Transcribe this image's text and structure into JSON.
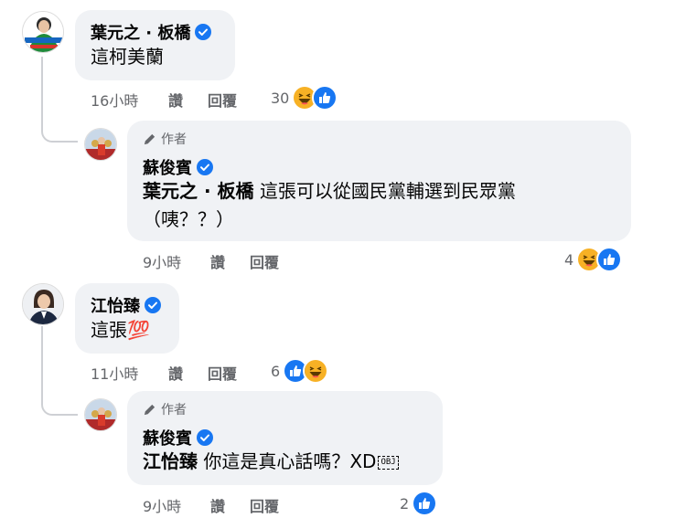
{
  "comments": [
    {
      "author": "葉元之 · 板橋",
      "text": "這柯美蘭",
      "time": "16小時",
      "like_label": "讚",
      "reply_label": "回覆",
      "reaction_count": "30",
      "reactions": [
        "haha",
        "like"
      ]
    },
    {
      "tag": "作者",
      "author": "蘇俊賓",
      "mention": "葉元之 · 板橋",
      "text_line1": "這張可以從國民黨輔選到民眾黨",
      "text_line2": "（咦？？）",
      "time": "9小時",
      "like_label": "讚",
      "reply_label": "回覆",
      "reaction_count": "4",
      "reactions": [
        "haha",
        "like"
      ]
    },
    {
      "author": "江怡臻",
      "text": "這張",
      "emoji_text": "💯",
      "time": "11小時",
      "like_label": "讚",
      "reply_label": "回覆",
      "reaction_count": "6",
      "reactions": [
        "like",
        "haha"
      ]
    },
    {
      "tag": "作者",
      "author": "蘇俊賓",
      "mention": "江怡臻",
      "text": "你這是真心話嗎？XD",
      "obj_glyph": "OBJ",
      "time": "9小時",
      "like_label": "讚",
      "reply_label": "回覆",
      "reaction_count": "2",
      "reactions": [
        "like"
      ]
    }
  ],
  "colors": {
    "like_blue": "#1877f2",
    "haha_yellow": "#f7b125",
    "bubble_bg": "#f0f2f5",
    "meta_gray": "#65676b"
  },
  "icons": [
    "verified-badge-icon",
    "pencil-icon",
    "like-reaction-icon",
    "haha-reaction-icon"
  ]
}
